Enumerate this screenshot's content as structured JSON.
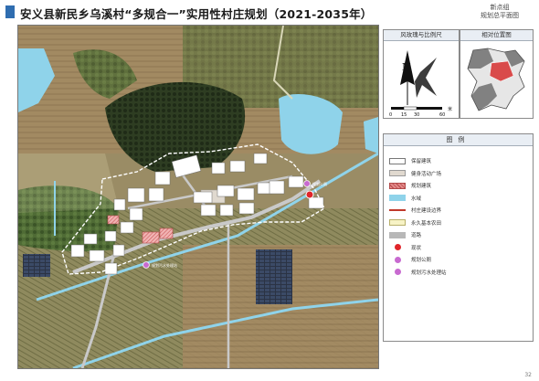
{
  "title": "安义县新民乡乌溪村“多规合一”实用性村庄规划（2021-2035年）",
  "subtitle_lines": [
    "新点组",
    "规划总平面图"
  ],
  "page_number": "32",
  "map_labels": {
    "annot_small_1": "规划公厕",
    "annot_small_2": "规划污水处理站"
  },
  "rose_panel": {
    "title": "风玫瑰与比例尺",
    "north": "N",
    "scale_ticks": [
      "0",
      "15",
      "30",
      "60"
    ],
    "scale_unit": "米"
  },
  "location_panel": {
    "title": "相对位置图"
  },
  "legend": {
    "title": "图例",
    "items": [
      {
        "label": "保留建筑",
        "color": "#ffffff",
        "border": "#777777",
        "kind": "box"
      },
      {
        "label": "健身活动广场",
        "color": "#e0d9cf",
        "border": "#9a9a9a",
        "kind": "box"
      },
      {
        "label": "规划建筑",
        "color": "#e58a8a",
        "border": "#b24a4a",
        "kind": "hatch"
      },
      {
        "label": "水域",
        "color": "#8fd3ea",
        "border": "#8fd3ea",
        "kind": "box"
      },
      {
        "label": "村庄建设边界",
        "color": "#c0392b",
        "border": "#c0392b",
        "kind": "line"
      },
      {
        "label": "永久基本农田",
        "color": "#f7f3c6",
        "border": "#b8b06a",
        "kind": "box"
      },
      {
        "label": "道路",
        "color": "#b8b8b8",
        "border": "#b8b8b8",
        "kind": "box"
      },
      {
        "label": "现状",
        "color": "#e0252a",
        "border": "#e0252a",
        "kind": "dot"
      },
      {
        "label": "规划公厕",
        "color": "#c86ad0",
        "border": "#c86ad0",
        "kind": "dot"
      },
      {
        "label": "规划污水处理站",
        "color": "#c86ad0",
        "border": "#c86ad0",
        "kind": "dot"
      }
    ]
  }
}
